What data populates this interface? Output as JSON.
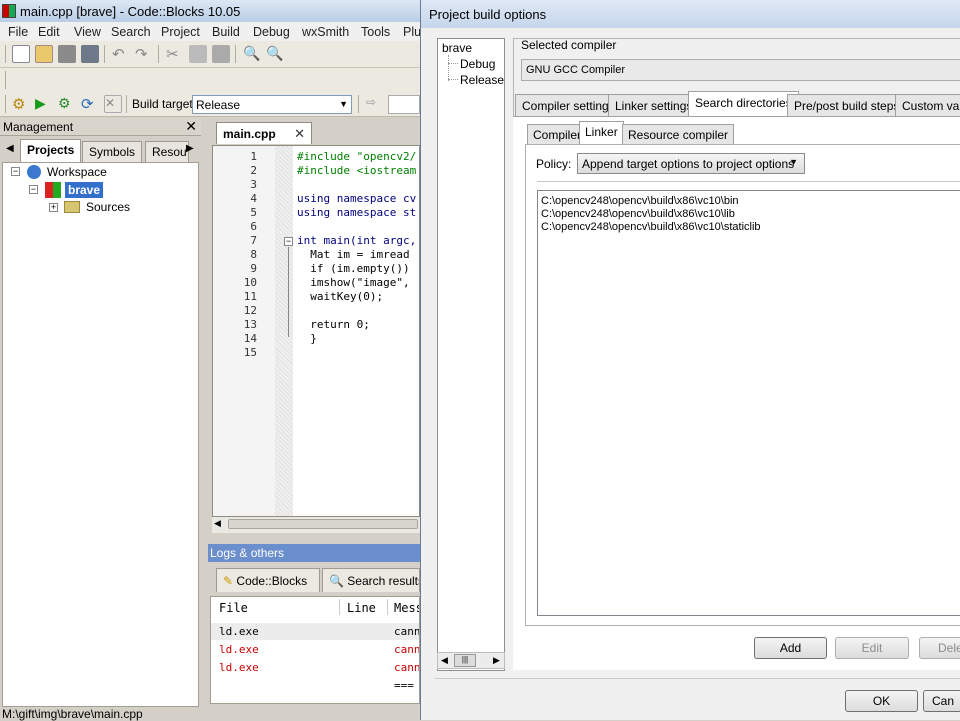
{
  "main_window": {
    "title": "main.cpp [brave] - Code::Blocks 10.05",
    "menu": [
      "File",
      "Edit",
      "View",
      "Search",
      "Project",
      "Build",
      "Debug",
      "wxSmith",
      "Tools",
      "Plu"
    ],
    "build_target_label": "Build target:",
    "build_target_value": "Release"
  },
  "management": {
    "title": "Management",
    "tabs": [
      "Projects",
      "Symbols",
      "Resou"
    ],
    "tree": {
      "workspace": "Workspace",
      "project": "brave",
      "folder": "Sources"
    }
  },
  "editor": {
    "tab_label": "main.cpp",
    "lines": [
      {
        "n": "1",
        "text": "#include \"opencv2/"
      },
      {
        "n": "2",
        "text": "#include <iostream"
      },
      {
        "n": "3",
        "text": ""
      },
      {
        "n": "4",
        "text": "using namespace cv"
      },
      {
        "n": "5",
        "text": "using namespace st"
      },
      {
        "n": "6",
        "text": ""
      },
      {
        "n": "7",
        "text": "int main(int argc,"
      },
      {
        "n": "8",
        "text": "  Mat im = imread"
      },
      {
        "n": "9",
        "text": "  if (im.empty())"
      },
      {
        "n": "10",
        "text": "  imshow(\"image\","
      },
      {
        "n": "11",
        "text": "  waitKey(0);"
      },
      {
        "n": "12",
        "text": ""
      },
      {
        "n": "13",
        "text": "  return 0;"
      },
      {
        "n": "14",
        "text": "  }"
      },
      {
        "n": "15",
        "text": ""
      }
    ]
  },
  "logs": {
    "title": "Logs & others",
    "tabs": [
      "Code::Blocks",
      "Search results"
    ],
    "columns": [
      "File",
      "Line",
      "Mess"
    ],
    "rows": [
      {
        "file": "ld.exe",
        "msg": "cann",
        "color": "#000000"
      },
      {
        "file": "ld.exe",
        "msg": "cann",
        "color": "#cc0000"
      },
      {
        "file": "ld.exe",
        "msg": "cann",
        "color": "#cc0000"
      },
      {
        "file": "",
        "msg": "===",
        "color": "#000000"
      }
    ]
  },
  "status_bar": "M:\\gift\\img\\brave\\main.cpp",
  "dialog": {
    "title": "Project build options",
    "tree": [
      "brave",
      "Debug",
      "Release"
    ],
    "selected_compiler_label": "Selected compiler",
    "selected_compiler": "GNU GCC Compiler",
    "tabs": [
      "Compiler settings",
      "Linker settings",
      "Search directories",
      "Pre/post build steps",
      "Custom varia"
    ],
    "subtabs": [
      "Compiler",
      "Linker",
      "Resource compiler"
    ],
    "policy_label": "Policy:",
    "policy_value": "Append target options to project options",
    "directories": [
      "C:\\opencv248\\opencv\\build\\x86\\vc10\\bin",
      "C:\\opencv248\\opencv\\build\\x86\\vc10\\lib",
      "C:\\opencv248\\opencv\\build\\x86\\vc10\\staticlib"
    ],
    "buttons": {
      "add": "Add",
      "edit": "Edit",
      "delete": "Dele",
      "ok": "OK",
      "cancel": "Can"
    }
  }
}
